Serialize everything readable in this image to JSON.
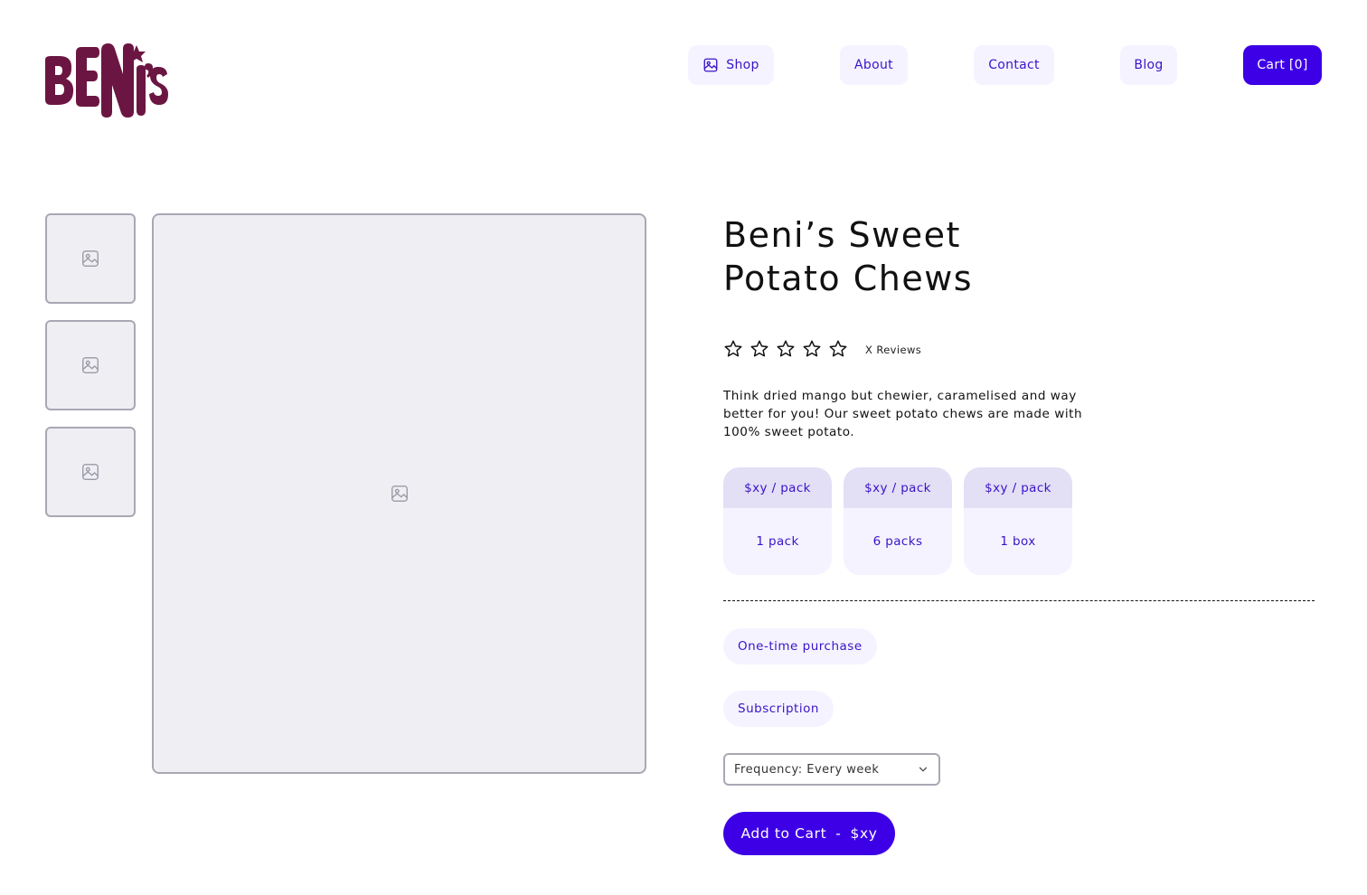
{
  "brand": {
    "logo_text": "BENi's",
    "logo_color": "#6b1642"
  },
  "nav": {
    "shop": "Shop",
    "about": "About",
    "contact": "Contact",
    "blog": "Blog",
    "cart": "Cart [0]"
  },
  "product": {
    "title_line1": "Beni’s Sweet",
    "title_line2": "Potato Chews",
    "rating_stars_filled": 0,
    "rating_stars_total": 5,
    "reviews": "X Reviews",
    "description": "Think dried mango but chewier, caramelised and way better for you! Our sweet potato chews are made with 100% sweet potato."
  },
  "pack_options": [
    {
      "price": "$xy / pack",
      "quantity": "1 pack"
    },
    {
      "price": "$xy / pack",
      "quantity": "6 packs"
    },
    {
      "price": "$xy / pack",
      "quantity": "1 box"
    }
  ],
  "purchase_options": {
    "one_time": "One-time purchase",
    "subscription": "Subscription"
  },
  "frequency": {
    "value": "Frequency: Every week"
  },
  "add_to_cart": {
    "label": "Add to Cart",
    "separator": "-",
    "price": "$xy"
  },
  "colors": {
    "accent": "#3d00e6",
    "accent_text": "#3a14c8",
    "chip_bg": "#f5f3ff",
    "chip_top_bg": "#e3dff5",
    "placeholder_bg": "#efeff3",
    "placeholder_border": "#a8a8b4"
  },
  "icons": {
    "nav_shop": "image-icon",
    "placeholder": "image-icon",
    "rating": "star-outline-icon",
    "dropdown": "chevron-down-icon"
  }
}
